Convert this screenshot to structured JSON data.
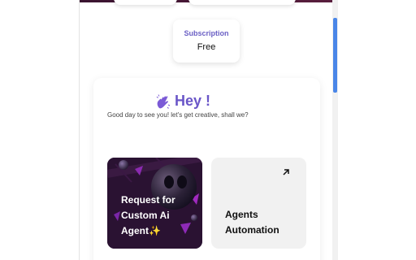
{
  "subscription": {
    "label": "Subscription",
    "value": "Free"
  },
  "greeting": {
    "title": "Hey !",
    "subtitle": "Good day to see you! let's get creative, shall we?",
    "icon": "waving-hand-icon"
  },
  "tiles": [
    {
      "title": "Request for Custom Ai Agent✨",
      "style": "dark",
      "icon": "decorative-3d-art"
    },
    {
      "title": "Agents Automation",
      "style": "light",
      "icon": "arrow-up-right-icon"
    }
  ],
  "colors": {
    "accent": "#6a56c8",
    "subscription_label": "#6a5fc4",
    "dark_tile": "#2a1232",
    "light_tile": "#f1f1f1",
    "scrollbar_thumb": "#4a86e8"
  }
}
